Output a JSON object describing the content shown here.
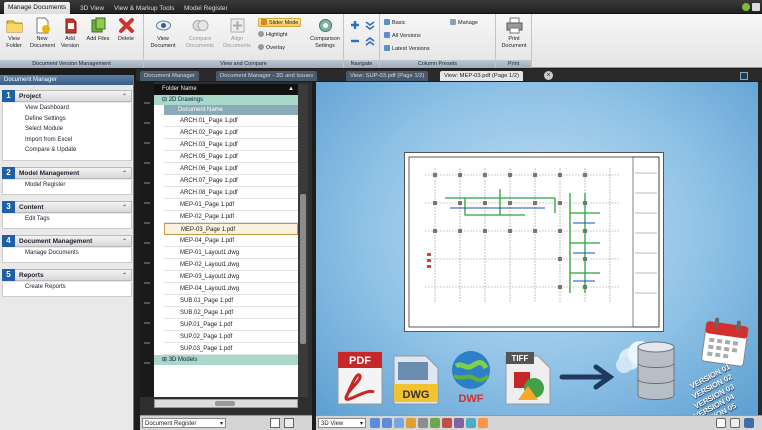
{
  "menu_tabs": [
    "Manage Documents",
    "3D View",
    "View & Markup Tools",
    "Model Register"
  ],
  "ribbon": {
    "document_version_management": {
      "label": "Document Version Management",
      "buttons": [
        "View Folder",
        "New Document",
        "Add Version",
        "Add Files",
        "Delete"
      ]
    },
    "view_and_compare": {
      "label": "View and Compare",
      "buttons": [
        "View Document",
        "Compare Documents",
        "Align Documents",
        "Comparison Settings"
      ],
      "modes": [
        "Slider Mode",
        "Highlight",
        "Overlay"
      ],
      "selected_mode": "Slider Mode"
    },
    "navigate": {
      "label": "Navigate"
    },
    "column_presets": {
      "label": "Column Presets",
      "items": [
        "Basic",
        "All Versions",
        "Latest Versions"
      ],
      "manage_label": "Manage"
    },
    "print": {
      "label": "Print",
      "button": "Print Document"
    }
  },
  "left_panel": {
    "title": "Document Manager",
    "sections": [
      {
        "num": "1",
        "title": "Project",
        "links": [
          "View Dashboard",
          "Define Settings",
          "Select Module",
          "Import from Excel",
          "Compare & Update"
        ]
      },
      {
        "num": "2",
        "title": "Model Management",
        "links": [
          "Model Register"
        ]
      },
      {
        "num": "3",
        "title": "Content",
        "links": [
          "Edit Tags"
        ]
      },
      {
        "num": "4",
        "title": "Document Management",
        "links": [
          "Manage Documents"
        ]
      },
      {
        "num": "5",
        "title": "Reports",
        "links": [
          "Create Reports"
        ]
      }
    ]
  },
  "doc_tabs": [
    "Document Manager",
    "Document Manager - 3D and Issues",
    "View: SUP-03.pdf (Page 1/2)",
    "View: MEP-03.pdf (Page 1/2)"
  ],
  "tree": {
    "header": "Folder Name",
    "folder_2d": "2D Drawings",
    "column": "Document Name",
    "files": [
      "ARCH.01_Page 1.pdf",
      "ARCH.02_Page 1.pdf",
      "ARCH.03_Page 1.pdf",
      "ARCH.05_Page 1.pdf",
      "ARCH.06_Page 1.pdf",
      "ARCH.07_Page 1.pdf",
      "ARCH.08_Page 1.pdf",
      "MEP-01_Page 1.pdf",
      "MEP-02_Page 1.pdf",
      "MEP-03_Page 1.pdf",
      "MEP-04_Page 1.pdf",
      "MEP-01_Layout1.dwg",
      "MEP-02_Layout1.dwg",
      "MEP-03_Layout1.dwg",
      "MEP-04_Layout1.dwg",
      "SUB.01_Page 1.pdf",
      "SUB.02_Page 1.pdf",
      "SUP.01_Page 1.pdf",
      "SUP.02_Page 1.pdf",
      "SUP.03_Page 1.pdf"
    ],
    "selected_file": "MEP-03_Page 1.pdf",
    "folder_3d": "3D Models",
    "footer_combo": "Document Register"
  },
  "viewer": {
    "footer_combo": "3D View",
    "file_types": [
      "PDF",
      "DWG",
      "DWF",
      "TIFF"
    ],
    "versions": [
      "VERSION 01",
      "VERSION 02",
      "VERSION 03",
      "VERSION 04",
      "VERSION 05"
    ]
  },
  "colors": {
    "accent_blue": "#1f5fa8",
    "tree_folder": "#a9d7c9",
    "viewer_bg": "#8fc2e6",
    "selection": "#f7c95a"
  }
}
